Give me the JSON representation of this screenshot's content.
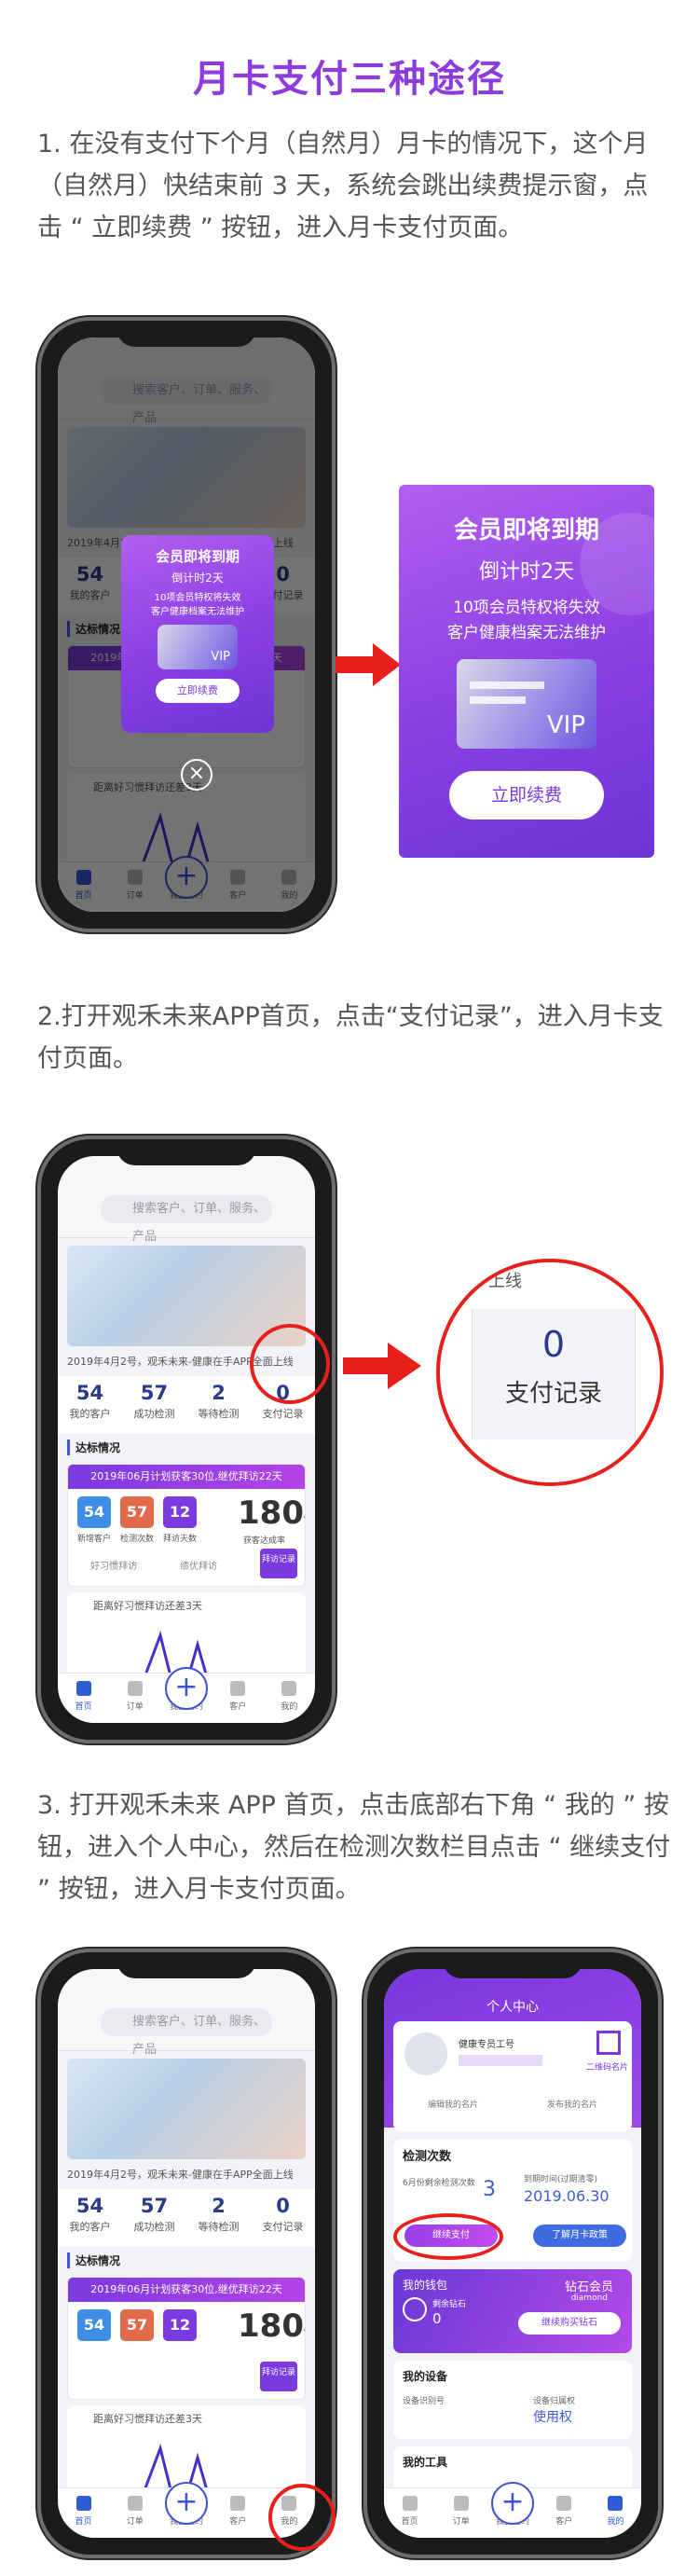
{
  "title": "月卡支付三种途径",
  "steps": [
    {
      "text": "1. 在没有支付下个月（自然月）月卡的情况下，这个月（自然月）快结束前 3 天，系统会跳出续费提示窗，点击 “ 立即续费 ” 按钮，进入月卡支付页面。"
    },
    {
      "text": "2.打开观禾未来APP首页，点击“支付记录”，进入月卡支付页面。"
    },
    {
      "text": "3. 打开观禾未来 APP 首页，点击底部右下角 “ 我的 ” 按钮，进入个人中心，然后在检测次数栏目点击 “ 继续支付 ” 按钮，进入月卡支付页面。"
    }
  ],
  "home": {
    "search_placeholder": "搜索客户、订单、服务、产品",
    "notice": "2019年4月2号，观禾未来-健康在手APP全面上线",
    "stats": [
      {
        "num": "54",
        "label": "我的客户"
      },
      {
        "num": "57",
        "label": "成功检测"
      },
      {
        "num": "2",
        "label": "等待检测"
      },
      {
        "num": "0",
        "label": "支付记录"
      }
    ],
    "section_title": "达标情况",
    "plan_header": "2019年06月计划获客30位,继优拜访22天",
    "chips": [
      {
        "num": "54",
        "label": "新增客户",
        "color": "#3f8ee6"
      },
      {
        "num": "57",
        "label": "检测次数",
        "color": "#e06a4a"
      },
      {
        "num": "12",
        "label": "拜访天数",
        "color": "#7a3ae0"
      }
    ],
    "big_num": "180",
    "big_unit": "%",
    "big_label": "获客达成率",
    "sub1": "好习惯拜访",
    "sub2": "绩优拜访",
    "plan_btn": "拜访记录",
    "goal_text": "距离好习惯拜访还差3天",
    "tabs": [
      "首页",
      "订单",
      "我要签约",
      "客户",
      "我的"
    ]
  },
  "modal": {
    "title": "会员即将到期",
    "countdown": "倒计时2天",
    "line1": "10项会员特权将失效",
    "line2": "客户健康档案无法维护",
    "vip": "VIP",
    "button": "立即续费",
    "close": "×"
  },
  "zoom": {
    "label": "支付记录",
    "num": "0",
    "top_text": "上线"
  },
  "profile": {
    "header": "个人中心",
    "name": "健康专员工号",
    "qr": "二维码名片",
    "edit": "编辑我的名片",
    "publish": "发布我的名片",
    "detect_title": "检测次数",
    "remain_label": "6月份剩余检测次数",
    "remain_num": "3",
    "expire_label": "到期时间(过期清零)",
    "expire_date": "2019.06.30",
    "continue_btn": "继续支付",
    "policy_btn": "了解月卡政策",
    "wallet": "我的钱包",
    "diamond_label": "剩余钻石",
    "diamond_num": "0",
    "member": "钻石会员",
    "member_en": "diamond",
    "buy": "继续购买钻石",
    "devices": "我的设备",
    "dev_id": "设备识别号",
    "dev_use": "设备归属权",
    "dev_val": "使用权",
    "tools": "我的工具"
  }
}
